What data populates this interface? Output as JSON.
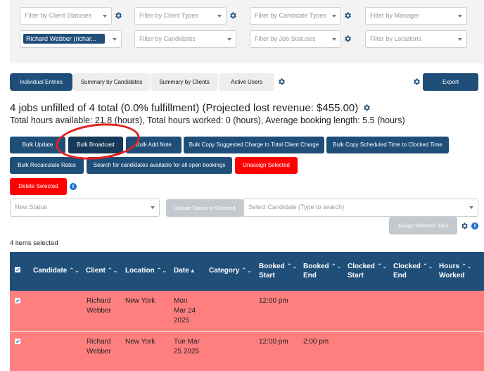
{
  "filters": {
    "client_statuses": "Filter by Client Statuses",
    "client_types": "Filter by Client Types",
    "candidate_types": "Filter by Candidate Types",
    "manager": "Filter by Manager",
    "selected_client": "Richard Webber (richar...",
    "candidates": "Filter by Candidates",
    "job_statuses": "Filter by Job Statuses",
    "locations": "Filter by Locations"
  },
  "tabs": [
    {
      "label": "Individual Entries",
      "active": true
    },
    {
      "label": "Summary by Candidates",
      "active": false
    },
    {
      "label": "Summary by Clients",
      "active": false
    },
    {
      "label": "Active Users",
      "active": false
    }
  ],
  "export_label": "Export",
  "summary": {
    "headline": "4 jobs unfilled of 4 total (0.0% fulfillment) (Projected lost revenue: $455.00)",
    "hours": "Total hours available: 21.8 (hours), Total hours worked: 0 (hours), Average booking length: 5.5 (hours)"
  },
  "actions": {
    "bulk_update": "Bulk Update",
    "bulk_broadcast": "Bulk Broadcast",
    "bulk_add_note": "Bulk Add Note",
    "bulk_copy_charge": "Bulk Copy Suggested Charge to Total Client Charge",
    "bulk_copy_time": "Bulk Copy Scheduled Time to Clocked Time",
    "bulk_recalculate": "Bulk Recalculate Rates",
    "search_candidates": "Search for candidates available for all open bookings",
    "unassign": "Unassign Selected",
    "delete": "Delete Selected"
  },
  "status_select": {
    "placeholder": "New Status"
  },
  "update_status_label": "Update Status of Selected",
  "candidate_select": {
    "placeholder": "Select Candidate (Type to search)"
  },
  "assign_label": "Assign Selected Jobs",
  "items_selected": "4 items selected",
  "table": {
    "headers": {
      "candidate": "Candidate",
      "client": "Client",
      "location": "Location",
      "date": "Date",
      "category": "Category",
      "booked_start_1": "Booked",
      "booked_start_2": "Start",
      "booked_end_1": "Booked",
      "booked_end_2": "End",
      "clocked_start_1": "Clocked",
      "clocked_start_2": "Start",
      "clocked_end_1": "Clocked",
      "clocked_end_2": "End",
      "hours_worked_1": "Hours",
      "hours_worked_2": "Worked"
    },
    "rows": [
      {
        "client_1": "Richard",
        "client_2": "Webber",
        "location": "New York",
        "date_1": "Mon",
        "date_2": "Mar 24",
        "date_3": "2025",
        "booked_start": "12:00 pm",
        "booked_end": ""
      },
      {
        "client_1": "Richard",
        "client_2": "Webber",
        "location": "New York",
        "date_1": "Tue Mar",
        "date_2": "25 2025",
        "date_3": "",
        "booked_start": "12:00 pm",
        "booked_end": "2:00 pm"
      }
    ]
  },
  "icons": {
    "gear": "gear-icon",
    "info": "info-icon",
    "check": "check-icon",
    "sort": "sort-icon"
  },
  "colors": {
    "primary": "#1f4e79",
    "danger": "#ff0000",
    "row_highlight": "#ff7f7f",
    "annotation": "#e3211c"
  }
}
